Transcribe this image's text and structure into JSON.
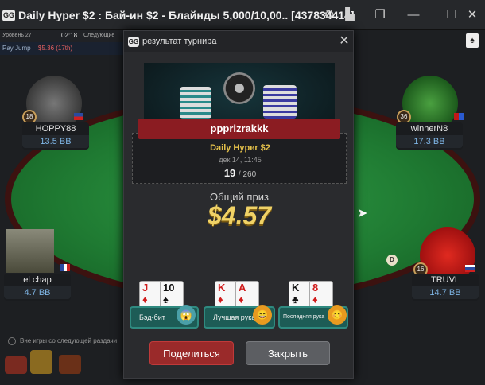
{
  "window": {
    "title": "Daily Hyper $2 : Бай-ин $2 - Блайнды 5,000/10,00.. [437834414]",
    "logo_text": "GG"
  },
  "status_bar": {
    "level_label": "Уровень 27",
    "level_time": "02:18",
    "next_label": "Следующие",
    "payjump_label": "Pay Jump",
    "payjump_value": "$5.36 (17th)"
  },
  "players": [
    {
      "name": "HOPPY88",
      "stack": "13.5 BB",
      "seat": "18"
    },
    {
      "name": "winnerN8",
      "stack": "17.3 BB",
      "seat": "36"
    },
    {
      "name": "el chap",
      "stack": "4.7 BB",
      "seat": ""
    },
    {
      "name": "TRUVL",
      "stack": "14.7 BB",
      "seat": "16"
    }
  ],
  "table": {
    "sitout_label": "Вне игры со следующей раздачи",
    "felt_color": "#1f7a32"
  },
  "modal": {
    "logo_text": "GG",
    "title": "результат турнира",
    "winner_name": "ppprizrakkk",
    "tournament_name": "Daily Hyper $2",
    "tournament_date": "дек 14, 11:45",
    "place": "19",
    "total_separator": "/ 260",
    "prize_label": "Общий приз",
    "prize_amount": "$4.57",
    "awards": [
      {
        "label": "Бэд-бит",
        "cards": [
          {
            "rank": "J",
            "suit": "♦"
          },
          {
            "rank": "10",
            "suit": "♠"
          }
        ]
      },
      {
        "label": "Лучшая рука",
        "cards": [
          {
            "rank": "K",
            "suit": "♦"
          },
          {
            "rank": "A",
            "suit": "♦"
          }
        ]
      },
      {
        "label": "Последняя рука",
        "cards": [
          {
            "rank": "K",
            "suit": "♣"
          },
          {
            "rank": "8",
            "suit": "♦"
          }
        ]
      }
    ],
    "share_label": "Поделиться",
    "close_label": "Закрыть"
  },
  "colors": {
    "accent_gold": "#e3c04a",
    "share_red": "#9a2a2a",
    "award_teal": "#1d5c56"
  }
}
